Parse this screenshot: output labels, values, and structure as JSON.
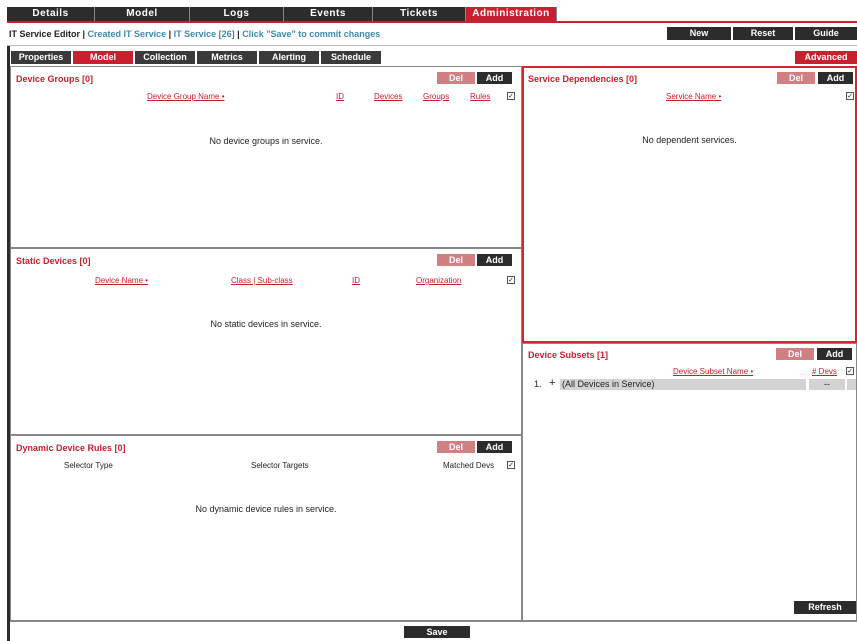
{
  "topnav": {
    "tabs": [
      {
        "label": "Details",
        "active": false
      },
      {
        "label": "Model",
        "active": false
      },
      {
        "label": "Logs",
        "active": false
      },
      {
        "label": "Events",
        "active": false
      },
      {
        "label": "Tickets",
        "active": false
      },
      {
        "label": "Administration",
        "active": true
      }
    ]
  },
  "titlebar": {
    "editor": "IT Service Editor | ",
    "created": "Created IT Service",
    "sep1": " | ",
    "service": "IT Service [26]",
    "sep2": " | ",
    "hint": "Click \"Save\" to commit changes",
    "new_label": "New",
    "reset_label": "Reset",
    "guide_label": "Guide"
  },
  "subtabs": {
    "tabs": [
      {
        "label": "Properties",
        "active": false
      },
      {
        "label": "Model",
        "active": true
      },
      {
        "label": "Collection",
        "active": false
      },
      {
        "label": "Metrics",
        "active": false
      },
      {
        "label": "Alerting",
        "active": false
      },
      {
        "label": "Schedule",
        "active": false
      }
    ],
    "advanced_label": "Advanced"
  },
  "device_groups": {
    "title": "Device Groups [0]",
    "del_label": "Del",
    "add_label": "Add",
    "columns": {
      "name": "Device Group Name •",
      "id": "ID",
      "devices": "Devices",
      "groups": "Groups",
      "rules": "Rules"
    },
    "empty": "No device groups in service."
  },
  "static_devices": {
    "title": "Static Devices [0]",
    "del_label": "Del",
    "add_label": "Add",
    "columns": {
      "name": "Device Name •",
      "class": "Class | Sub-class",
      "id": "ID",
      "org": "Organization"
    },
    "empty": "No static devices in service."
  },
  "dynamic_rules": {
    "title": "Dynamic Device Rules [0]",
    "del_label": "Del",
    "add_label": "Add",
    "columns": {
      "type": "Selector Type",
      "targets": "Selector Targets",
      "matched": "Matched Devs"
    },
    "empty": "No dynamic device rules in service."
  },
  "service_dependencies": {
    "title": "Service Dependencies [0]",
    "del_label": "Del",
    "add_label": "Add",
    "columns": {
      "name": "Service Name •"
    },
    "empty": "No dependent services."
  },
  "device_subsets": {
    "title": "Device Subsets [1]",
    "del_label": "Del",
    "add_label": "Add",
    "columns": {
      "name": "Device Subset Name •",
      "devs": "# Devs"
    },
    "rows": [
      {
        "num": "1.",
        "plus": "+",
        "name": "(All Devices in Service)",
        "devs": "--"
      }
    ],
    "refresh_label": "Refresh"
  },
  "footer": {
    "save_label": "Save"
  },
  "colors": {
    "accent": "#c8202e",
    "dark": "#2c2c2c",
    "link": "#3a8bb5",
    "del": "#d07f83"
  }
}
